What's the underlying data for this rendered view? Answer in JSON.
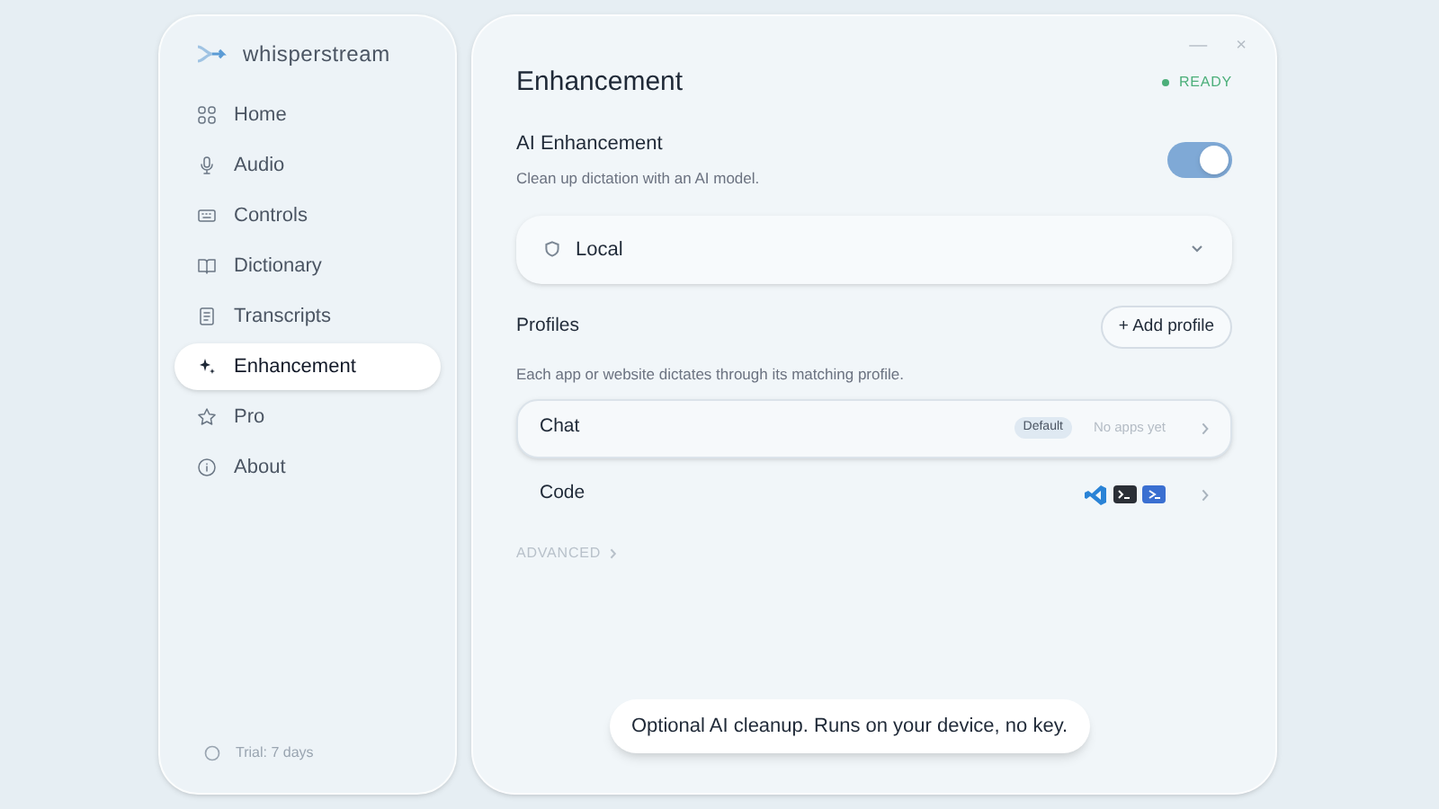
{
  "sidebar": {
    "app_name": "whisperstream",
    "items": [
      {
        "label": "Home",
        "kind": "grid",
        "selected": false
      },
      {
        "label": "Audio",
        "kind": "mic",
        "selected": false
      },
      {
        "label": "Controls",
        "kind": "keyboard",
        "selected": false
      },
      {
        "label": "Dictionary",
        "kind": "book",
        "selected": false
      },
      {
        "label": "Transcripts",
        "kind": "doc",
        "selected": false
      },
      {
        "label": "Enhancement",
        "kind": "sparkle",
        "selected": true
      },
      {
        "label": "Pro",
        "kind": "star",
        "selected": false
      },
      {
        "label": "About",
        "kind": "info",
        "selected": false
      }
    ],
    "trial": "Trial: 7 days"
  },
  "window_controls": {
    "minimize": "—",
    "close": "×"
  },
  "page": {
    "title": "Enhancement",
    "status": "READY",
    "ai_enhancement": {
      "label": "AI Enhancement",
      "description": "Clean up dictation with an AI model.",
      "on": true
    },
    "provider": {
      "value": "Local"
    },
    "profiles": {
      "label": "Profiles",
      "add_button": "+ Add profile",
      "description": "Each app or website dictates through its matching profile.",
      "items": [
        {
          "name": "Chat",
          "kind": "note",
          "selected": true,
          "badge": "Default",
          "note": "No apps yet"
        },
        {
          "name": "Code",
          "kind": "apps",
          "selected": false
        }
      ]
    },
    "advanced": "ADVANCED"
  },
  "caption": "Optional AI cleanup. Runs on your device, no key."
}
